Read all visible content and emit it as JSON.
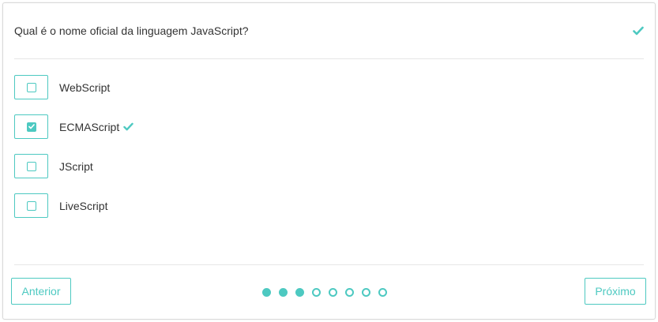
{
  "question": {
    "text": "Qual é o nome oficial da linguagem JavaScript?",
    "status_icon": "check-icon"
  },
  "options": [
    {
      "label": "WebScript",
      "checked": false,
      "correct": false
    },
    {
      "label": "ECMAScript",
      "checked": true,
      "correct": true
    },
    {
      "label": "JScript",
      "checked": false,
      "correct": false
    },
    {
      "label": "LiveScript",
      "checked": false,
      "correct": false
    }
  ],
  "navigation": {
    "prev_label": "Anterior",
    "next_label": "Próximo",
    "pages_total": 8,
    "pages_answered": 3
  },
  "colors": {
    "accent": "#4dc9c1",
    "text": "#333333",
    "border": "#d9d9d9",
    "divider": "#e6e6e6"
  }
}
